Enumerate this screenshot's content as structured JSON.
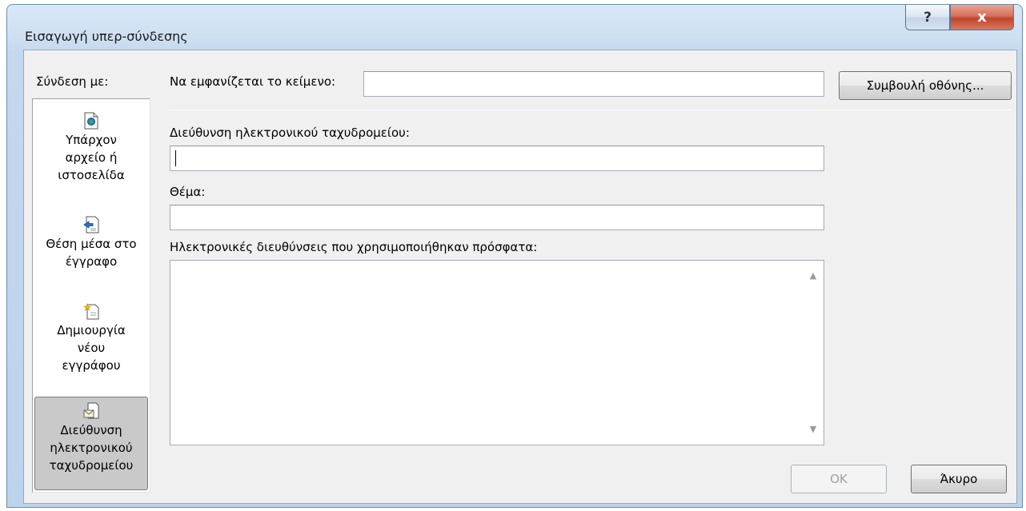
{
  "window": {
    "title": "Εισαγωγή υπερ-σύνδεσης",
    "help_glyph": "?",
    "close_glyph": "x"
  },
  "link_with": {
    "label": "Σύνδεση με:",
    "items": [
      {
        "line1": "Υπάρχον",
        "line2": "αρχείο ή",
        "line3": "ιστοσελίδα",
        "icon": "existing-file-icon"
      },
      {
        "line1": "Θέση μέσα στο",
        "line2": "έγγραφο",
        "icon": "place-in-document-icon"
      },
      {
        "line1": "Δημιουργία",
        "line2": "νέου",
        "line3": "εγγράφου",
        "icon": "new-document-icon"
      },
      {
        "line1": "Διεύθυνση",
        "line2": "ηλεκτρονικού",
        "line3": "ταχυδρομείου",
        "icon": "email-address-icon",
        "selected": true
      }
    ]
  },
  "display_text": {
    "label": "Να εμφανίζεται το κείμενο:",
    "value": ""
  },
  "screen_tip_button": "Συμβουλή οθόνης...",
  "email": {
    "label": "Διεύθυνση ηλεκτρονικού ταχυδρομείου:",
    "value": ""
  },
  "subject": {
    "label": "Θέμα:",
    "value": ""
  },
  "recent": {
    "label": "Ηλεκτρονικές διευθύνσεις που χρησιμοποιήθηκαν πρόσφατα:",
    "items": []
  },
  "buttons": {
    "ok": "OK",
    "cancel": "Άκυρο"
  }
}
